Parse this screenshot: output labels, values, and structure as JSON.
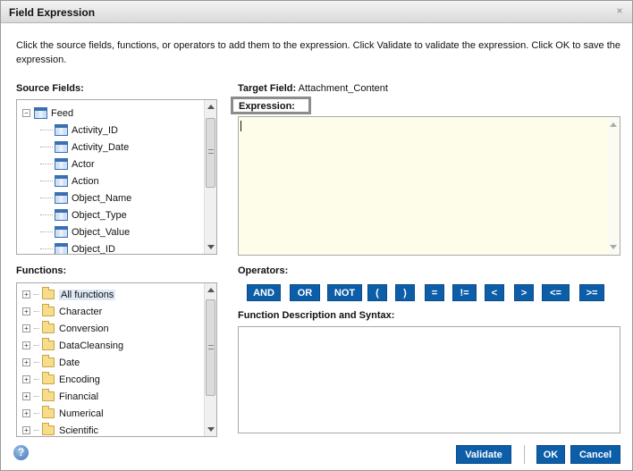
{
  "dialog": {
    "title": "Field Expression",
    "close_glyph": "×",
    "instructions": "Click the source fields, functions, or operators to add them to the expression. Click Validate to validate the expression. Click OK to save the expression."
  },
  "source_fields": {
    "label": "Source Fields:",
    "root": "Feed",
    "items": [
      "Activity_ID",
      "Activity_Date",
      "Actor",
      "Action",
      "Object_Name",
      "Object_Type",
      "Object_Value",
      "Object_ID"
    ]
  },
  "functions": {
    "label": "Functions:",
    "items": [
      "All functions",
      "Character",
      "Conversion",
      "DataCleansing",
      "Date",
      "Encoding",
      "Financial",
      "Numerical",
      "Scientific"
    ]
  },
  "target": {
    "label": "Target Field:",
    "value": "Attachment_Content"
  },
  "expression": {
    "label": "Expression:",
    "value": ""
  },
  "operators": {
    "label": "Operators:",
    "buttons": [
      "AND",
      "OR",
      "NOT",
      "(",
      ")",
      "=",
      "!=",
      "<",
      ">",
      "<=",
      ">="
    ]
  },
  "description": {
    "label": "Function Description and Syntax:"
  },
  "footer": {
    "help_glyph": "?",
    "validate_label": "Validate",
    "ok_label": "OK",
    "cancel_label": "Cancel"
  },
  "icons": {
    "expander_minus": "−",
    "expander_plus": "+"
  }
}
